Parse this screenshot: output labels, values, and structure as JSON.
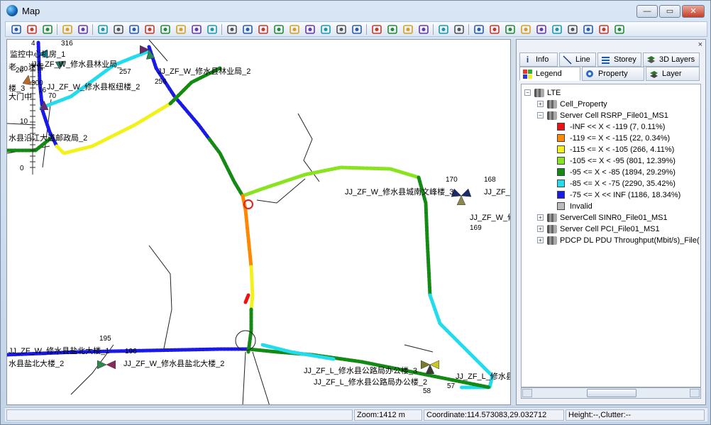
{
  "window": {
    "title": "Map",
    "min_label": "—",
    "max_label": "▭",
    "close_label": "✕"
  },
  "colors": {
    "red": "#ee1111",
    "orange": "#ff8800",
    "yellow": "#f2f21a",
    "lime": "#88e41c",
    "green": "#138a13",
    "cyan": "#22dcee",
    "blue": "#1a1ae8",
    "invalid": "#bbbbbb",
    "road": "#222222"
  },
  "toolbar": {
    "icons": [
      "copy-icon",
      "paste-icon",
      "text-icon",
      "back-arrow-icon",
      "pan-icon",
      "wireless-icon",
      "grid-icon",
      "site-icon",
      "cell-icon",
      "ruler-icon",
      "pencil-icon",
      "measure-icon",
      "globe-icon",
      "duplicate-icon",
      "save-icon",
      "bird-icon",
      "pin-icon",
      "ball-icon",
      "radio-icon",
      "refresh-icon",
      "eraser-icon",
      "check-icon",
      "route-icon",
      "export-icon",
      "layers-icon",
      "tool-icon",
      "gear-icon",
      "marker-icon",
      "select-arrow-icon",
      "hand-icon",
      "zoom-in-icon",
      "zoom-out-icon",
      "fit-icon",
      "zoom-box-icon",
      "zoom-layer-icon",
      "print-icon",
      "stack-icon",
      "flag-icon"
    ]
  },
  "panel": {
    "close": "×",
    "tabs_row1": [
      {
        "label": "Info",
        "icon": "info-icon"
      },
      {
        "label": "Line",
        "icon": "line-icon"
      },
      {
        "label": "Storey",
        "icon": "storey-icon"
      },
      {
        "label": "3D Layers",
        "icon": "3d-layers-icon"
      }
    ],
    "tabs_row2": [
      {
        "label": "Legend",
        "icon": "legend-icon"
      },
      {
        "label": "Property",
        "icon": "property-icon"
      },
      {
        "label": "Layer",
        "icon": "layer-icon"
      }
    ],
    "tree": {
      "root": "LTE",
      "nodes": [
        {
          "label": "Cell_Property",
          "expand": "+"
        },
        {
          "label": "Server Cell RSRP_File01_MS1",
          "expand": "−"
        },
        {
          "label": "ServerCell SINR0_File01_MS1",
          "expand": "+"
        },
        {
          "label": "Server Cell PCI_File01_MS1",
          "expand": "+"
        },
        {
          "label": "PDCP DL PDU Throughput(Mbit/s)_File(",
          "expand": "+"
        }
      ],
      "legend": [
        {
          "label": "-INF << X < -119  (7,  0.11%)",
          "color": "#ee1111"
        },
        {
          "label": "-119 <= X < -115  (22,  0.34%)",
          "color": "#ff8800"
        },
        {
          "label": "-115 <= X < -105  (266,  4.11%)",
          "color": "#f2f21a"
        },
        {
          "label": "-105 <= X < -95  (801,  12.39%)",
          "color": "#88e41c"
        },
        {
          "label": "-95 <= X < -85  (1894,  29.29%)",
          "color": "#138a13"
        },
        {
          "label": "-85 <= X < -75  (2290,  35.42%)",
          "color": "#22dcee"
        },
        {
          "label": "-75 <= X << INF  (1186,  18.34%)",
          "color": "#1a1ae8"
        },
        {
          "label": "Invalid",
          "color": "#bbbbbb"
        }
      ]
    }
  },
  "map": {
    "labels": [
      {
        "text": "监控中心机房_1"
      },
      {
        "text": "JJ_ZF_W_修水县林业局_"
      },
      {
        "text": "JJ_ZF_W_修水县林业局_2"
      },
      {
        "text": "JJ_ZF_W_修水县枢纽楼_2"
      },
      {
        "text": "水县沿江大道邮政局_2"
      },
      {
        "text": "JJ_ZF_W_修水县城南文峰楼_3"
      },
      {
        "text": "JJ_ZF_W_修"
      },
      {
        "text": "JJ_ZF_W_修"
      },
      {
        "text": "JJ_ZF_W_修水县盐北大楼_1"
      },
      {
        "text": "JJ_ZF_W_修水县盐北大楼_2"
      },
      {
        "text": "水县盐北大楼_2"
      },
      {
        "text": "JJ_ZF_L_修水县公路局办公楼_3"
      },
      {
        "text": "JJ_ZF_L_修水县公路局办公楼_2"
      },
      {
        "text": "JJ_ZF_L_修水县公"
      },
      {
        "text": "楼_3"
      },
      {
        "text": "大门中"
      },
      {
        "text": "迷雪"
      },
      {
        "text": "老"
      }
    ],
    "site_numbers": [
      "316",
      "257",
      "256",
      "170",
      "168",
      "169",
      "195",
      "196",
      "58",
      "57",
      "16",
      "20",
      "4",
      "300",
      "70"
    ],
    "scale_ticks": [
      "20",
      "10",
      "0"
    ]
  },
  "status": {
    "zoom": "Zoom:1412 m",
    "coordinate": "Coordinate:114.573083,29.032712",
    "height": "Height:--,Clutter:--"
  }
}
